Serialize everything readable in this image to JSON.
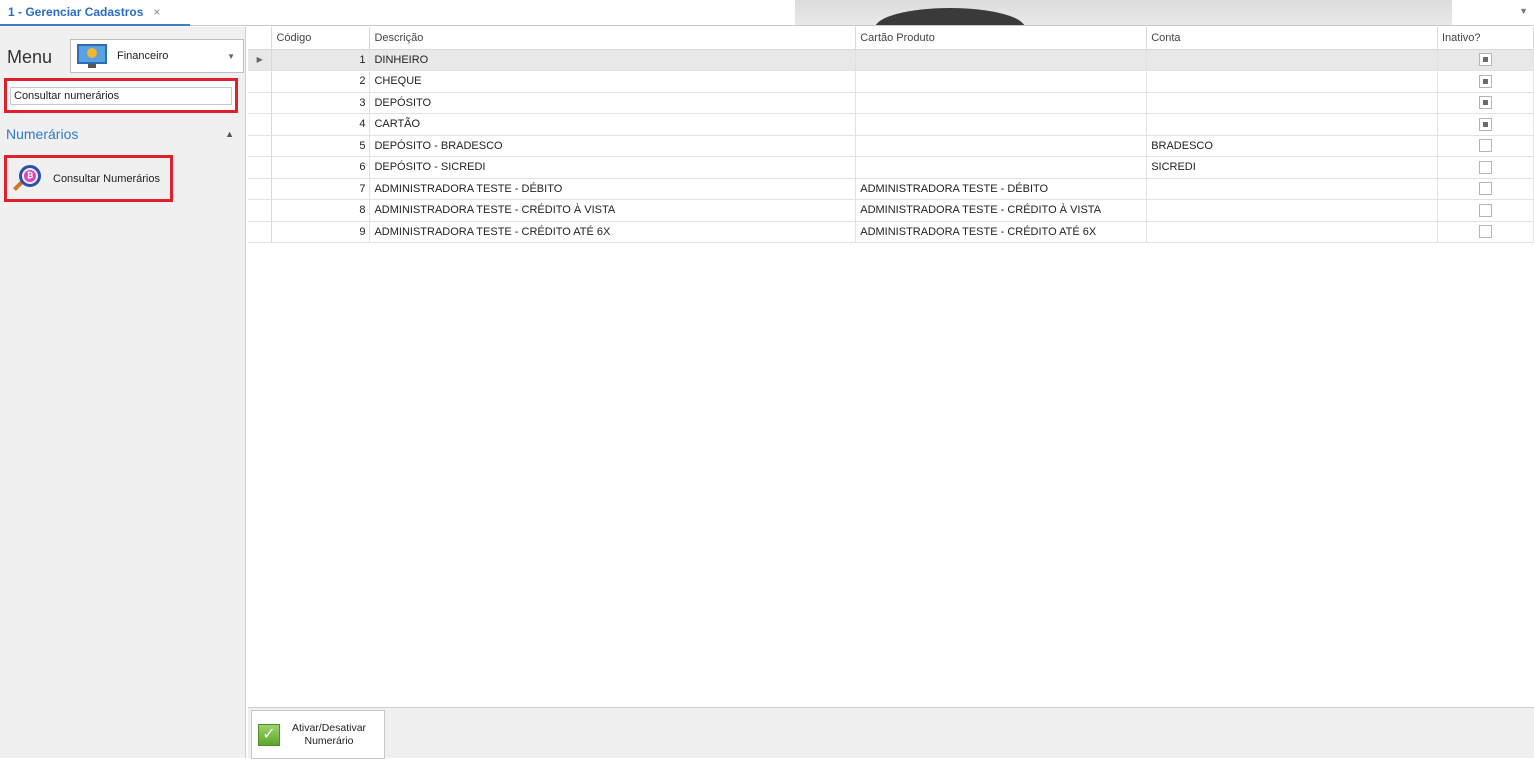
{
  "tab": {
    "title": "1 - Gerenciar Cadastros",
    "close": "×"
  },
  "sidebar": {
    "menu_label": "Menu",
    "module": "Financeiro",
    "search_value": "Consultar numerários",
    "group_title": "Numerários",
    "nav_item": "Consultar Numerários",
    "icons": {
      "module": "monitor-coin-icon",
      "nav": "magnifier-coin-icon"
    }
  },
  "grid": {
    "headers": [
      "Código",
      "Descrição",
      "Cartão Produto",
      "Conta",
      "Inativo?"
    ],
    "rows": [
      {
        "codigo": "1",
        "descricao": "DINHEIRO",
        "cartao": "",
        "conta": "",
        "inativo": true
      },
      {
        "codigo": "2",
        "descricao": "CHEQUE",
        "cartao": "",
        "conta": "",
        "inativo": true
      },
      {
        "codigo": "3",
        "descricao": "DEPÓSITO",
        "cartao": "",
        "conta": "",
        "inativo": true
      },
      {
        "codigo": "4",
        "descricao": "CARTÃO",
        "cartao": "",
        "conta": "",
        "inativo": true
      },
      {
        "codigo": "5",
        "descricao": "DEPÓSITO - BRADESCO",
        "cartao": "",
        "conta": "BRADESCO",
        "inativo": false
      },
      {
        "codigo": "6",
        "descricao": "DEPÓSITO - SICREDI",
        "cartao": "",
        "conta": "SICREDI",
        "inativo": false
      },
      {
        "codigo": "7",
        "descricao": "ADMINISTRADORA TESTE - DÉBITO",
        "cartao": "ADMINISTRADORA TESTE - DÉBITO",
        "conta": "",
        "inativo": false
      },
      {
        "codigo": "8",
        "descricao": "ADMINISTRADORA TESTE - CRÉDITO À VISTA",
        "cartao": "ADMINISTRADORA TESTE - CRÉDITO À VISTA",
        "conta": "",
        "inativo": false
      },
      {
        "codigo": "9",
        "descricao": "ADMINISTRADORA TESTE - CRÉDITO ATÉ 6X",
        "cartao": "ADMINISTRADORA TESTE - CRÉDITO ATÉ 6X",
        "conta": "",
        "inativo": false
      }
    ],
    "selected_row": 0
  },
  "toolbar": {
    "toggle_button": "Ativar/Desativar\nNumerário",
    "toggle_icon": "check-icon"
  },
  "colors": {
    "accent": "#2f79c7",
    "highlight": "#e0202a",
    "selected_row": "#e8e8e8"
  }
}
